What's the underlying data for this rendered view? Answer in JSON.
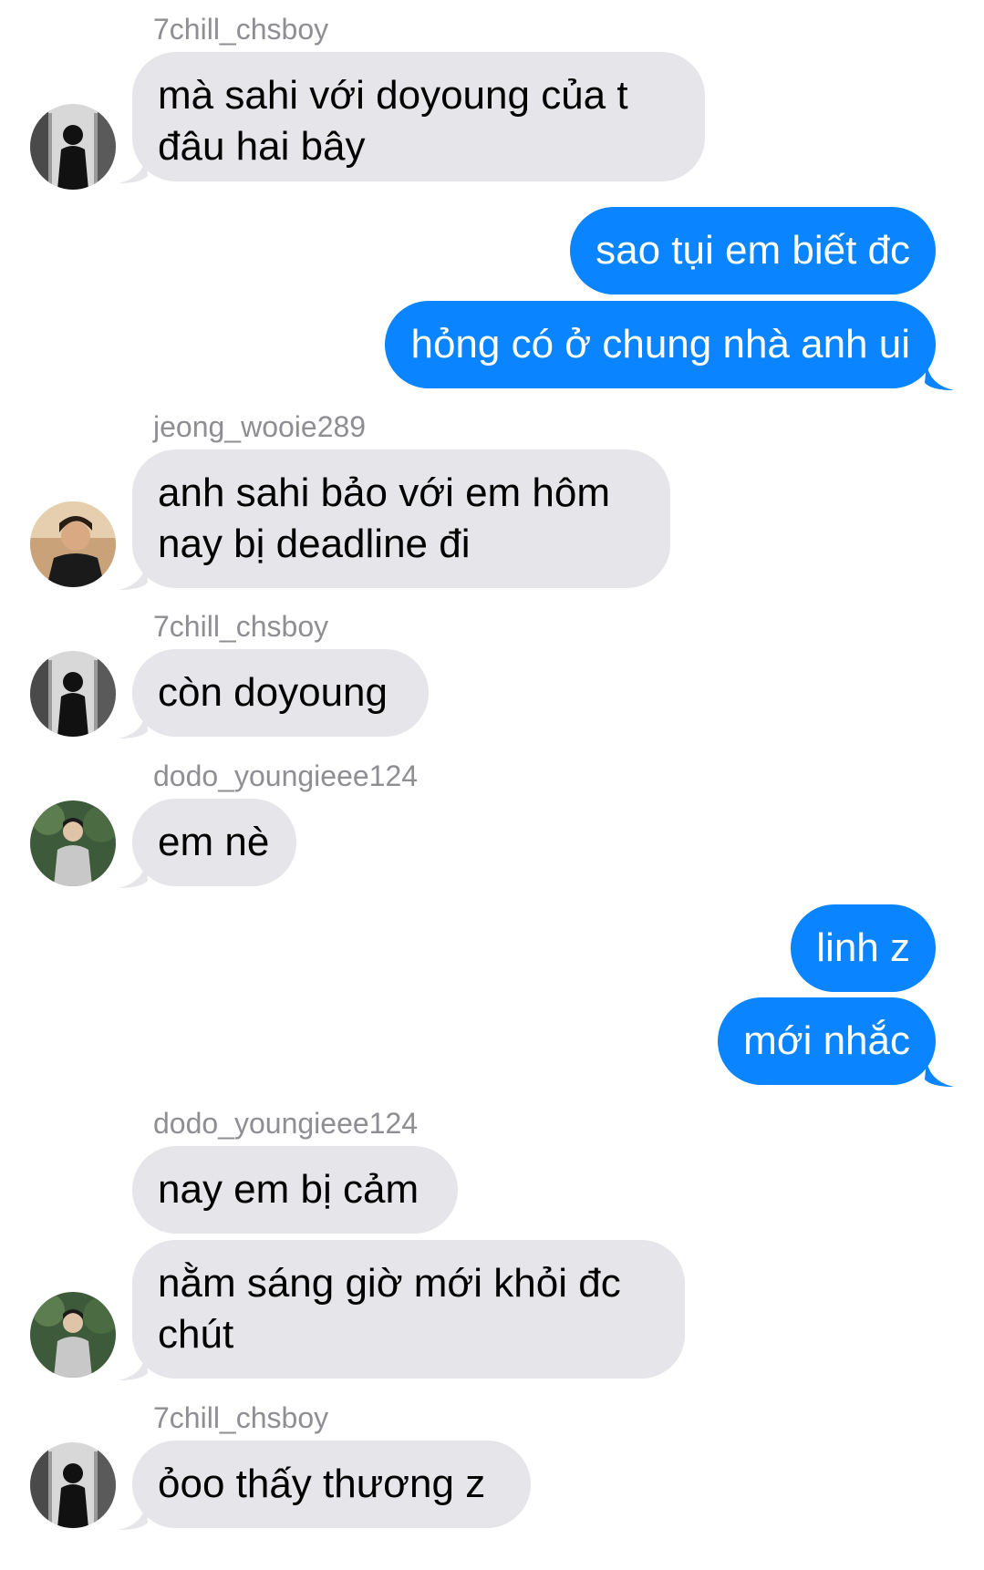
{
  "messages": [
    {
      "sender": "7chill_chsboy",
      "text_lines": [
        "mà sahi với doyoung của t",
        "đâu hai bây"
      ]
    },
    {
      "outgoing": true,
      "text": "sao tụi em biết đc"
    },
    {
      "outgoing": true,
      "text": "hỏng có ở chung nhà anh ui"
    },
    {
      "sender": "jeong_wooie289",
      "text_lines": [
        "anh sahi bảo với em hôm",
        "nay bị deadline đi"
      ]
    },
    {
      "sender": "7chill_chsboy",
      "text": "còn doyoung"
    },
    {
      "sender": "dodo_youngieee124",
      "text": "em nè"
    },
    {
      "outgoing": true,
      "text": "linh z"
    },
    {
      "outgoing": true,
      "text": "mới nhắc"
    },
    {
      "sender": "dodo_youngieee124",
      "text": "nay em bị cảm"
    },
    {
      "text_lines": [
        "nằm sáng giờ mới khỏi đc",
        "chút"
      ]
    },
    {
      "sender": "7chill_chsboy",
      "text": "ỏoo thấy thương z"
    }
  ],
  "colors": {
    "incoming_bubble": "#e5e5ea",
    "outgoing_bubble": "#0a84ff",
    "sender_name": "#8e8e93"
  },
  "icons": {
    "avatar_7chill": "avatar-7chill-chsboy",
    "avatar_jeong": "avatar-jeong-wooie289",
    "avatar_dodo": "avatar-dodo-youngieee124"
  }
}
